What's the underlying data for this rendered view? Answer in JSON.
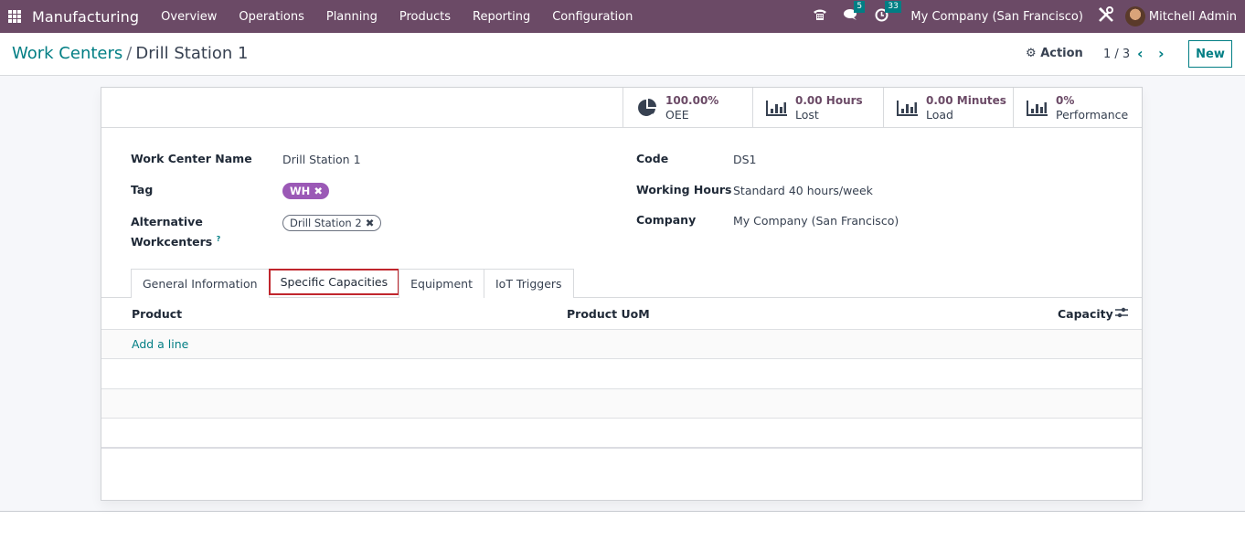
{
  "navbar": {
    "app_name": "Manufacturing",
    "menu": [
      "Overview",
      "Operations",
      "Planning",
      "Products",
      "Reporting",
      "Configuration"
    ],
    "messages_count": "5",
    "activities_count": "33",
    "company": "My Company (San Francisco)",
    "user": "Mitchell Admin",
    "icons": {
      "apps": "apps-grid-icon",
      "phone": "phone-icon",
      "messages": "chat-bubble-icon",
      "activities": "clock-icon",
      "debug": "tools-icon"
    }
  },
  "control_panel": {
    "breadcrumb_parent": "Work Centers",
    "breadcrumb_separator": "/",
    "breadcrumb_current": "Drill Station 1",
    "action_label": "Action",
    "pager": "1 / 3",
    "new_label": "New"
  },
  "stats": [
    {
      "value": "100.00%",
      "label": "OEE",
      "icon": "pie-chart-icon"
    },
    {
      "value": "0.00 Hours",
      "label": "Lost",
      "icon": "bar-chart-icon"
    },
    {
      "value": "0.00 Minutes",
      "label": "Load",
      "icon": "bar-chart-icon"
    },
    {
      "value": "0%",
      "label": "Performance",
      "icon": "bar-chart-icon"
    }
  ],
  "form": {
    "name_label": "Work Center Name",
    "name_value": "Drill Station 1",
    "tag_label": "Tag",
    "tag_value": "WH",
    "tag_color": "#9b59b6",
    "alt_label_1": "Alternative",
    "alt_label_2": "Workcenters",
    "alt_help": "?",
    "alt_value": "Drill Station 2",
    "code_label": "Code",
    "code_value": "DS1",
    "hours_label": "Working Hours",
    "hours_value": "Standard 40 hours/week",
    "company_label": "Company",
    "company_value": "My Company (San Francisco)"
  },
  "tabs": [
    {
      "label": "General Information",
      "active": false
    },
    {
      "label": "Specific Capacities",
      "active": true
    },
    {
      "label": "Equipment",
      "active": false
    },
    {
      "label": "IoT Triggers",
      "active": false
    }
  ],
  "table": {
    "columns": [
      "Product",
      "Product UoM",
      "Capacity"
    ],
    "add_line": "Add a line",
    "rows": []
  },
  "colors": {
    "navbar": "#6b4a66",
    "accent": "#017e84",
    "highlight": "#c0262d"
  }
}
